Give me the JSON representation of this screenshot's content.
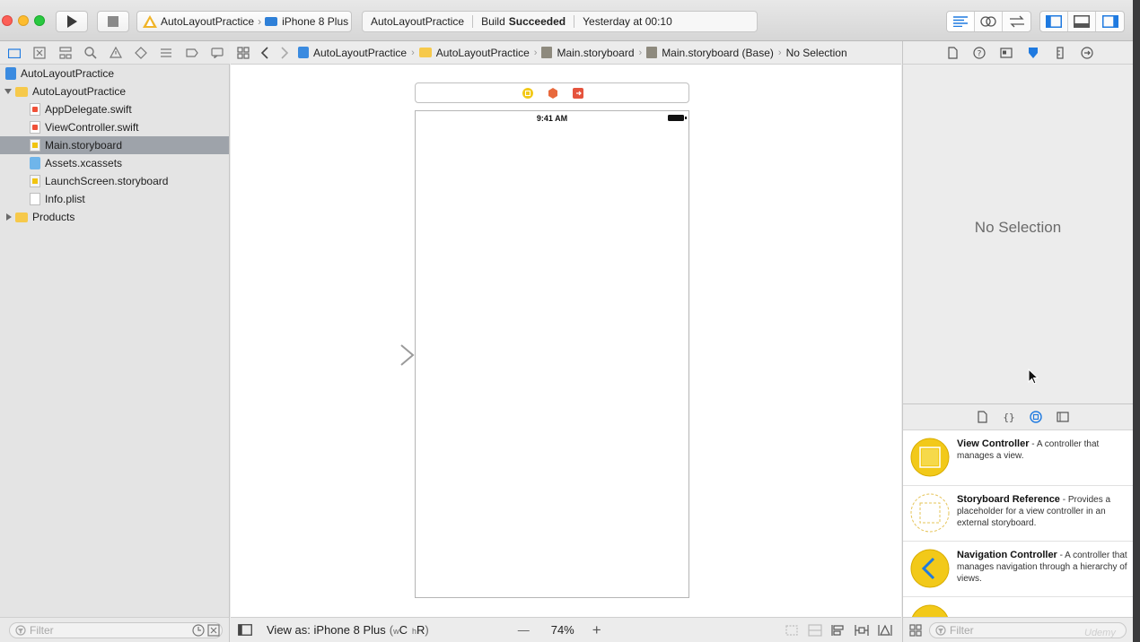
{
  "toolbar": {
    "scheme_name": "AutoLayoutPractice",
    "device_name": "iPhone 8 Plus",
    "activity_project": "AutoLayoutPractice",
    "activity_build_prefix": "Build",
    "activity_build_status": "Succeeded",
    "activity_time": "Yesterday at 00:10"
  },
  "navigator": {
    "items": [
      {
        "label": "AutoLayoutPractice",
        "icon": "project-icon"
      },
      {
        "label": "AutoLayoutPractice",
        "icon": "folder-icon"
      },
      {
        "label": "AppDelegate.swift",
        "icon": "swift-file-icon"
      },
      {
        "label": "ViewController.swift",
        "icon": "swift-file-icon"
      },
      {
        "label": "Main.storyboard",
        "icon": "storyboard-file-icon"
      },
      {
        "label": "Assets.xcassets",
        "icon": "assets-icon"
      },
      {
        "label": "LaunchScreen.storyboard",
        "icon": "storyboard-file-icon"
      },
      {
        "label": "Info.plist",
        "icon": "plist-file-icon"
      },
      {
        "label": "Products",
        "icon": "folder-icon"
      }
    ],
    "filter_placeholder": "Filter"
  },
  "jumpbar": {
    "crumbs": [
      "AutoLayoutPractice",
      "AutoLayoutPractice",
      "Main.storyboard",
      "Main.storyboard (Base)",
      "No Selection"
    ]
  },
  "canvas": {
    "status_time": "9:41 AM",
    "view_as_label": "View as: iPhone 8 Plus",
    "size_class_w": "w",
    "size_class_c": "C",
    "size_class_h": "h",
    "size_class_r": "R",
    "zoom_minus": "—",
    "zoom_level": "74%",
    "zoom_plus": "+"
  },
  "inspector": {
    "no_selection": "No Selection"
  },
  "library": {
    "items": [
      {
        "title": "View Controller",
        "desc": " - A controller that manages a view."
      },
      {
        "title": "Storyboard Reference",
        "desc": " - Provides a placeholder for a view controller in an external storyboard."
      },
      {
        "title": "Navigation Controller",
        "desc": " - A controller that manages navigation through a hierarchy of views."
      }
    ],
    "filter_placeholder": "Filter"
  },
  "watermark": "Udemy",
  "colors": {
    "library_yellow": "#f2c919",
    "selection_gray": "#9ea3aa",
    "accent_blue": "#1f7ae0"
  }
}
